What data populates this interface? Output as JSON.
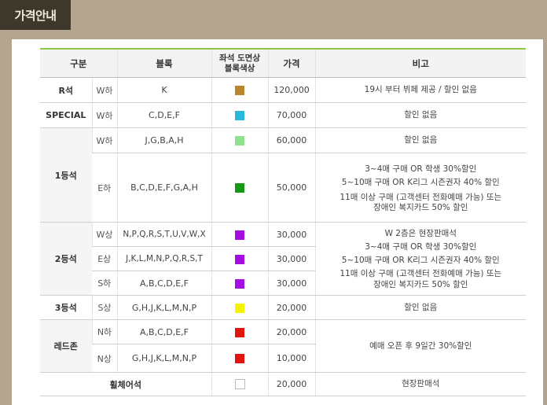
{
  "title": "가격안내",
  "headers": {
    "category": "구분",
    "block": "블록",
    "color_line1": "좌석 도면상",
    "color_line2": "블록색상",
    "price": "가격",
    "note": "비고"
  },
  "rows": {
    "r": {
      "group": "R석",
      "tier": "W하",
      "block": "K",
      "color": "#b8862f",
      "price": "120,000",
      "note": "19시 부터 뷔페 제공 / 할인 없음"
    },
    "special": {
      "group": "SPECIAL",
      "tier": "W하",
      "block": "C,D,E,F",
      "color": "#2ab9dd",
      "price": "70,000",
      "note": "할인 없음"
    },
    "first": {
      "group": "1등석",
      "w": {
        "tier": "W하",
        "block": "J,G,B,A,H",
        "color": "#8fe08f",
        "price": "60,000",
        "note": "할인 없음"
      },
      "e": {
        "tier": "E하",
        "block": "B,C,D,E,F,G,A,H",
        "color": "#159a15",
        "price": "50,000",
        "note": [
          "3~4매 구매 OR 학생 30%할인",
          "5~10매 구매 OR K리그 시즌권자 40% 할인",
          "11매 이상 구매 (고객센터 전화예매 가능) 또는",
          "장애인 복지카드 50% 할인"
        ]
      }
    },
    "second": {
      "group": "2등석",
      "w": {
        "tier": "W상",
        "block": "N,P,Q,R,S,T,U,V,W,X",
        "color": "#a40ee0",
        "price": "30,000"
      },
      "e": {
        "tier": "E상",
        "block": "J,K,L,M,N,P,Q,R,S,T",
        "color": "#a40ee0",
        "price": "30,000"
      },
      "s": {
        "tier": "S하",
        "block": "A,B,C,D,E,F",
        "color": "#a40ee0",
        "price": "30,000"
      },
      "note": [
        "W 2층은 현장판매석",
        "3~4매 구매 OR 학생 30%할인",
        "5~10매 구매 OR K리그 시즌권자 40% 할인",
        "11매 이상 구매 (고객센터 전화예매 가능) 또는",
        "장애인 복지카드 50% 할인"
      ]
    },
    "third": {
      "group": "3등석",
      "tier": "S상",
      "block": "G,H,J,K,L,M,N,P",
      "color": "#f6f10b",
      "price": "20,000",
      "note": "할인 없음"
    },
    "red": {
      "group": "레드존",
      "n_low": {
        "tier": "N하",
        "block": "A,B,C,D,E,F",
        "color": "#e0150f",
        "price": "20,000"
      },
      "n_high": {
        "tier": "N상",
        "block": "G,H,J,K,L,M,N,P",
        "color": "#e0150f",
        "price": "10,000"
      },
      "note": "예매 오픈 후 9일간 30%할인"
    },
    "wheelchair": {
      "group": "휠체어석",
      "color": "#ffffff",
      "price": "20,000",
      "note": "현장판매석"
    }
  }
}
